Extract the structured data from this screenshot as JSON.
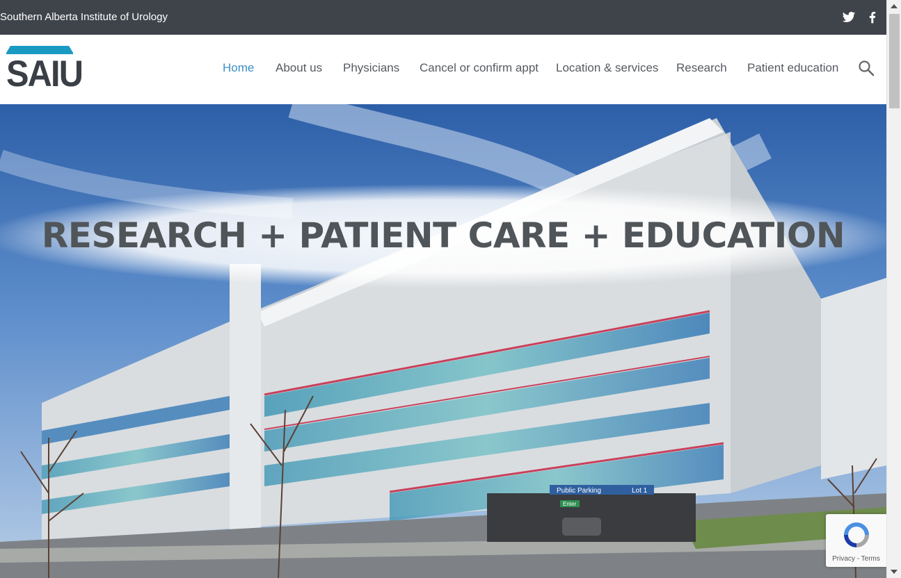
{
  "topbar": {
    "site_name": "Southern Alberta Institute of Urology",
    "social": [
      {
        "icon": "twitter-icon"
      },
      {
        "icon": "facebook-icon"
      }
    ]
  },
  "logo": {
    "text": "SAIU",
    "bar_color": "#1a9ac2"
  },
  "nav": {
    "items": [
      {
        "label": "Home",
        "active": true
      },
      {
        "label": "About us",
        "active": false
      },
      {
        "label": "Physicians",
        "active": false
      },
      {
        "label": "Cancel or confirm appt",
        "active": false
      },
      {
        "label": "Location & services",
        "active": false
      },
      {
        "label": "Research",
        "active": false
      },
      {
        "label": "Patient education",
        "active": false
      }
    ],
    "search_icon": "search-icon"
  },
  "hero": {
    "headline": "RESEARCH + PATIENT CARE + EDUCATION",
    "signage": {
      "parking": "Public Parking",
      "lot": "Lot 1",
      "enter": "Enter"
    }
  },
  "recaptcha": {
    "links": "Privacy - Terms"
  },
  "colors": {
    "topbar_bg": "#3f444b",
    "nav_active": "#3b8fc6",
    "nav_text": "#555a60"
  }
}
